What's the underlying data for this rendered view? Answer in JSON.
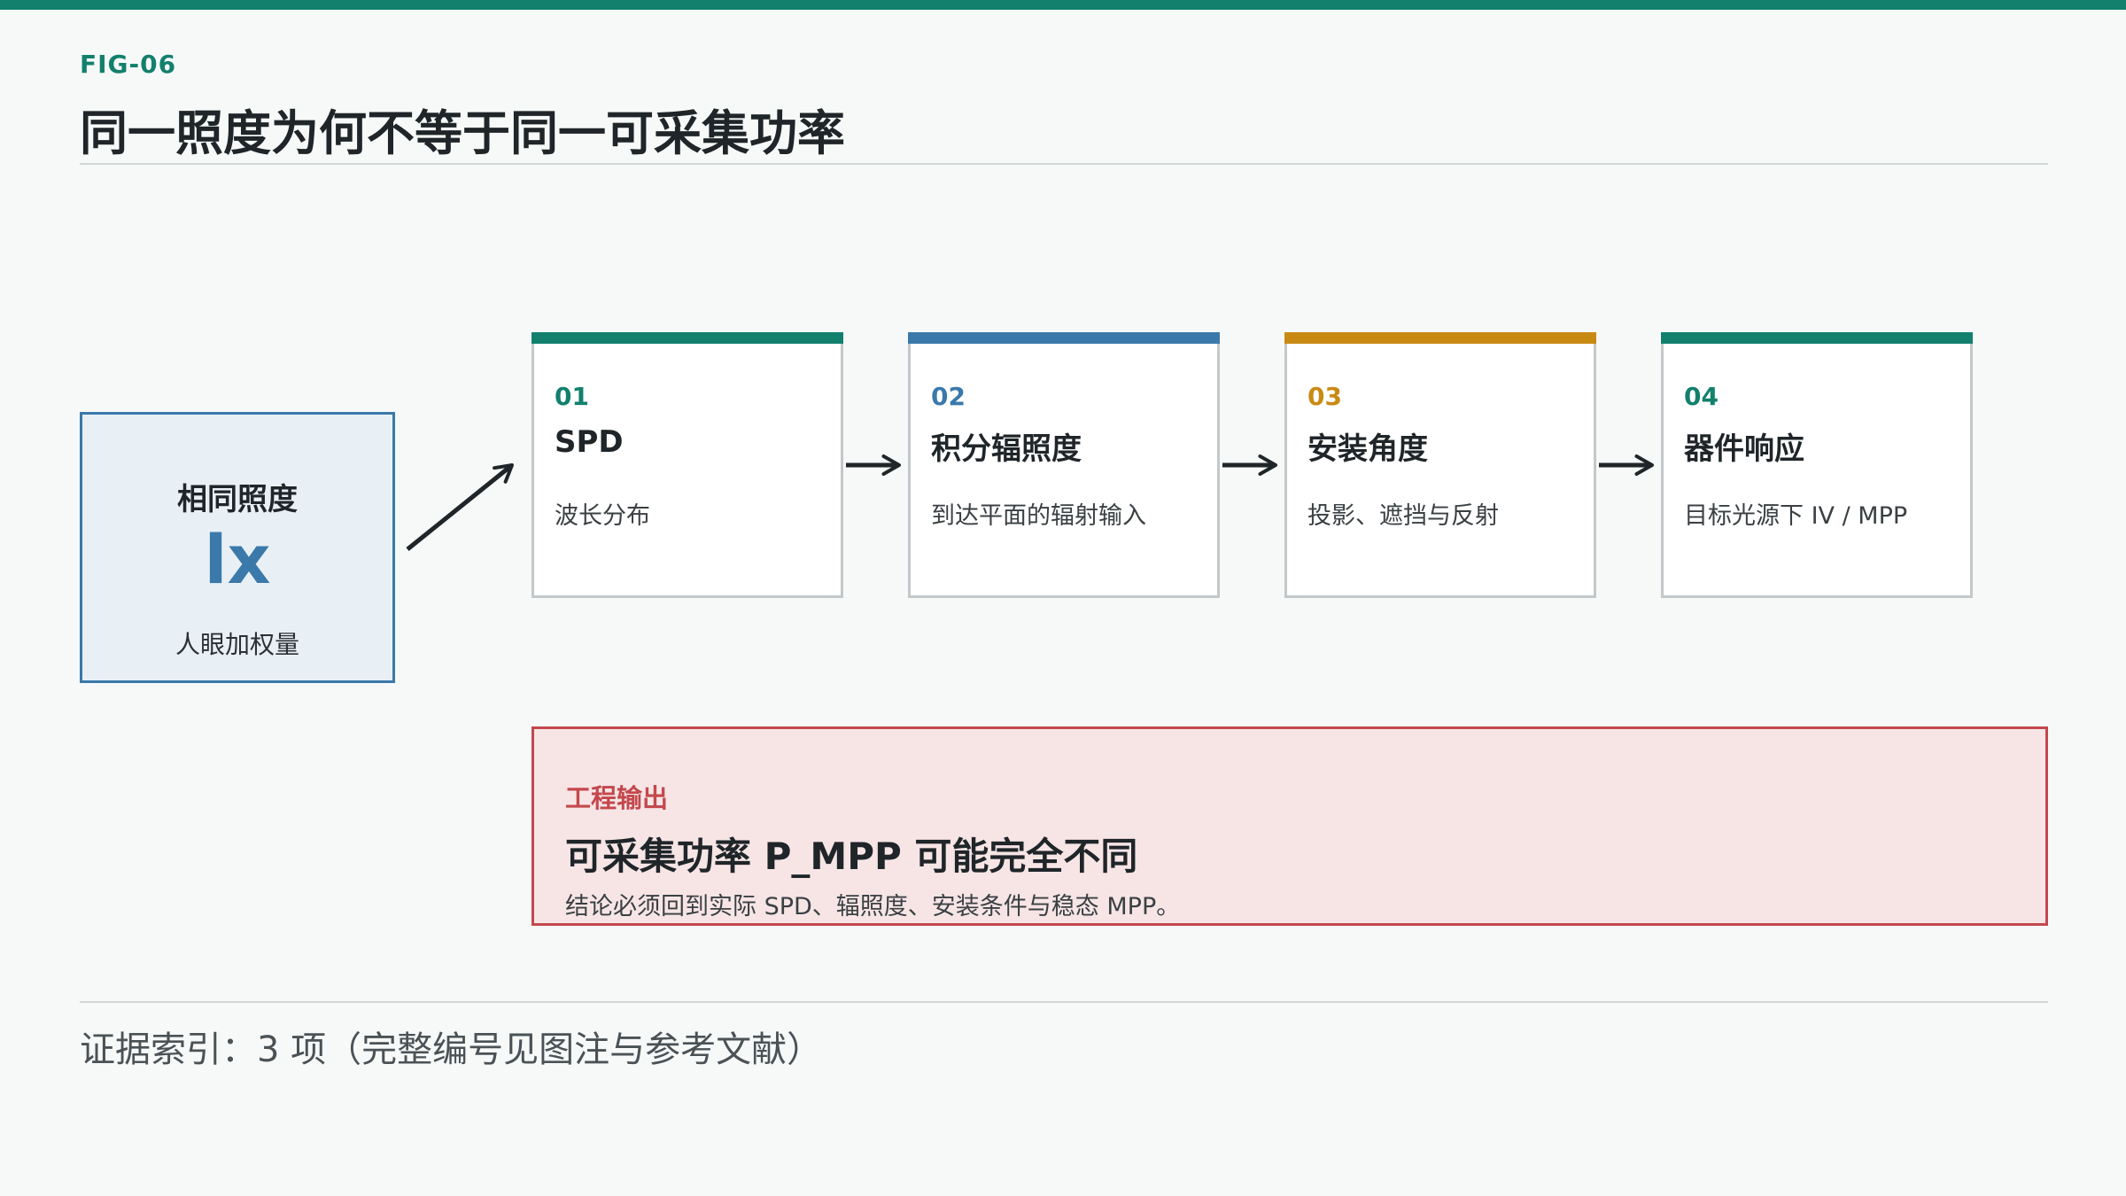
{
  "figure": {
    "label": "FIG-06",
    "title": "同一照度为何不等于同一可采集功率"
  },
  "input": {
    "title": "相同照度",
    "unit": "lx",
    "subtitle": "人眼加权量"
  },
  "steps": [
    {
      "num": "01",
      "name": "SPD",
      "desc": "波长分布",
      "color": "#12806d"
    },
    {
      "num": "02",
      "name": "积分辐照度",
      "desc": "到达平面的辐射输入",
      "color": "#3b79aa"
    },
    {
      "num": "03",
      "name": "安装角度",
      "desc": "投影、遮挡与反射",
      "color": "#c98a14"
    },
    {
      "num": "04",
      "name": "器件响应",
      "desc": "目标光源下 IV / MPP",
      "color": "#12806d"
    }
  ],
  "output": {
    "label": "工程输出",
    "title": "可采集功率 P_MPP 可能完全不同",
    "subtitle": "结论必须回到实际 SPD、辐照度、安装条件与稳态 MPP。"
  },
  "footer": {
    "text": "证据索引：3 项（完整编号见图注与参考文献）"
  },
  "colors": {
    "accent": "#12806d",
    "blue": "#3b79aa",
    "amber": "#c98a14",
    "red": "#c3484d"
  }
}
